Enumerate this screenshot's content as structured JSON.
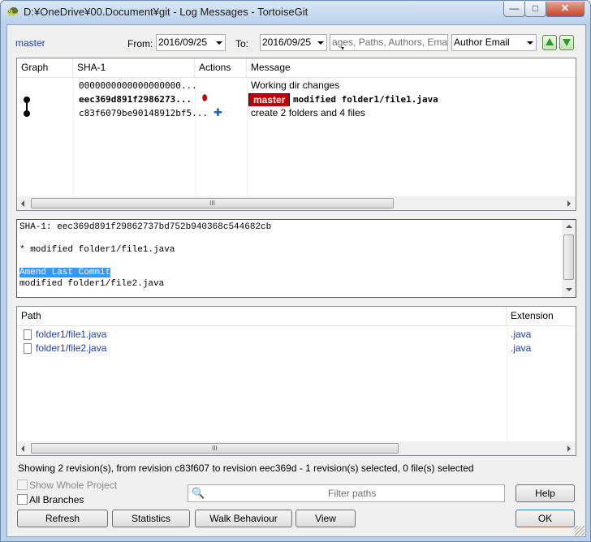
{
  "window": {
    "title": "D:¥OneDrive¥00.Document¥git - Log Messages - TortoiseGit",
    "min_glyph": "—",
    "max_glyph": "□",
    "close_glyph": "✕"
  },
  "toolbar": {
    "branch": "master",
    "from_label": "From:",
    "from_date": "2016/09/25",
    "to_label": "To:",
    "to_date": "2016/09/25",
    "search_placeholder": "ages, Paths, Authors, Emails,",
    "filter_field": "Author Email"
  },
  "log": {
    "headers": {
      "graph": "Graph",
      "sha": "SHA-1",
      "actions": "Actions",
      "message": "Message"
    },
    "rows": [
      {
        "sha": "0000000000000000000...",
        "message": "Working dir changes"
      },
      {
        "sha": "eec369d891f2986273...",
        "ref": "master",
        "message": "modified folder1/file1.java"
      },
      {
        "sha": "c83f6079be90148912bf5...",
        "message": "create 2 folders and 4 files"
      }
    ]
  },
  "commit_detail": {
    "sha_line": "SHA-1: eec369d891f29862737bd752b940368c544682cb",
    "subject": "* modified folder1/file1.java",
    "selected": "Amend Last Commit",
    "body": "modified folder1/file2.java"
  },
  "files": {
    "headers": {
      "path": "Path",
      "extension": "Extension"
    },
    "rows": [
      {
        "path": "folder1/file1.java",
        "ext": ".java"
      },
      {
        "path": "folder1/file2.java",
        "ext": ".java"
      }
    ]
  },
  "status": "Showing 2 revision(s), from revision c83f607 to revision eec369d - 1 revision(s) selected, 0 file(s) selected",
  "options": {
    "show_whole_project": "Show Whole Project",
    "all_branches": "All Branches"
  },
  "filter_paths_placeholder": "Filter paths",
  "buttons": {
    "help": "Help",
    "refresh": "Refresh",
    "statistics": "Statistics",
    "walk": "Walk Behaviour",
    "view": "View",
    "ok": "OK"
  },
  "colors": {
    "master_badge": "#c00000",
    "link": "#1a3dbd",
    "selection": "#3399ff"
  }
}
